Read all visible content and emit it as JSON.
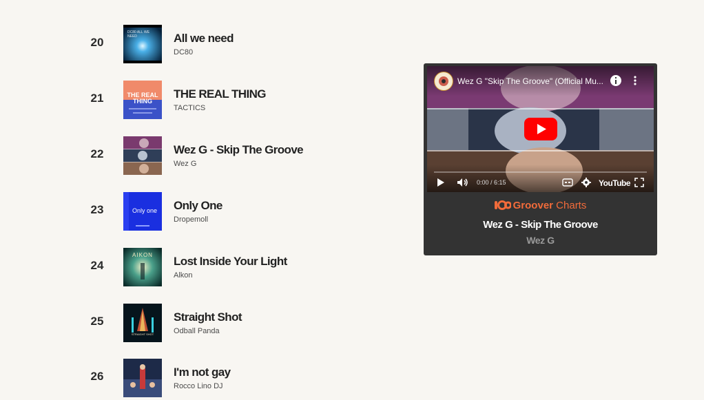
{
  "chart": {
    "rows": [
      {
        "rank": "20",
        "title": "All we need",
        "artist": "DC80",
        "cover_text": "DC80 ALL WE NEED"
      },
      {
        "rank": "21",
        "title": "THE REAL THING",
        "artist": "TACTICS",
        "cover_text": "THE REAL THING"
      },
      {
        "rank": "22",
        "title": "Wez G - Skip The Groove",
        "artist": "Wez G",
        "cover_text": ""
      },
      {
        "rank": "23",
        "title": "Only One",
        "artist": "Dropemoll",
        "cover_text": "Only one"
      },
      {
        "rank": "24",
        "title": "Lost Inside Your Light",
        "artist": "Alkon",
        "cover_text": "AIKON"
      },
      {
        "rank": "25",
        "title": "Straight Shot",
        "artist": "Odball Panda",
        "cover_text": "STRAIGHT SHOT"
      },
      {
        "rank": "26",
        "title": "I'm not gay",
        "artist": "Rocco Lino DJ",
        "cover_text": ""
      }
    ]
  },
  "player": {
    "video_title": "Wez G \"Skip The Groove\" (Official Mu...",
    "time": "0:00 / 6:15",
    "youtube_label": "YouTube",
    "brand": {
      "bold": "Groover",
      "light": "Charts"
    },
    "now_playing_title": "Wez G - Skip The Groove",
    "now_playing_artist": "Wez G"
  },
  "colors": {
    "background": "#f8f6f2",
    "card": "#333333",
    "brand_orange": "#f26b3a",
    "youtube_red": "#ff0000"
  }
}
